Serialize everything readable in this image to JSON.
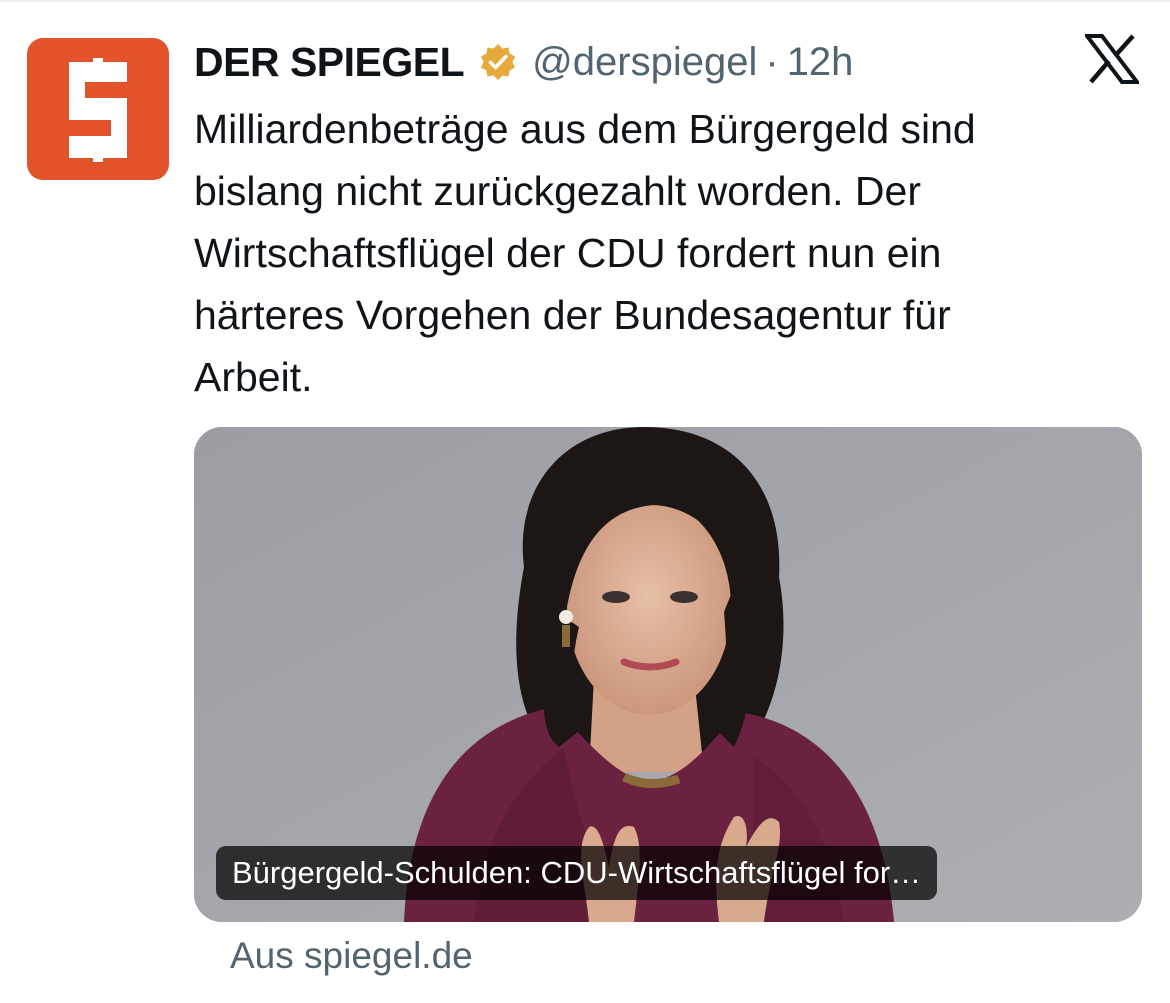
{
  "author": {
    "name": "DER SPIEGEL",
    "handle": "@derspiegel",
    "separator": "·",
    "time": "12h",
    "avatar_letter": "S",
    "avatar_color": "#e2532c",
    "verified_badge_color": "#e8a93b"
  },
  "tweet": {
    "lines": [
      "Milliardenbeträge aus dem Bürgergeld sind",
      "bislang nicht zurückgezahlt worden. Der",
      "Wirtschaftsflügel der CDU fordert nun ein",
      "härteres Vorgehen der Bundesagentur für",
      "Arbeit."
    ]
  },
  "card": {
    "caption": "Bürgergeld-Schulden: CDU-Wirtschaftsflügel for…",
    "source": "Aus spiegel.de"
  },
  "icons": {
    "platform_logo": "x-logo-icon",
    "verified": "verified-badge-icon"
  }
}
